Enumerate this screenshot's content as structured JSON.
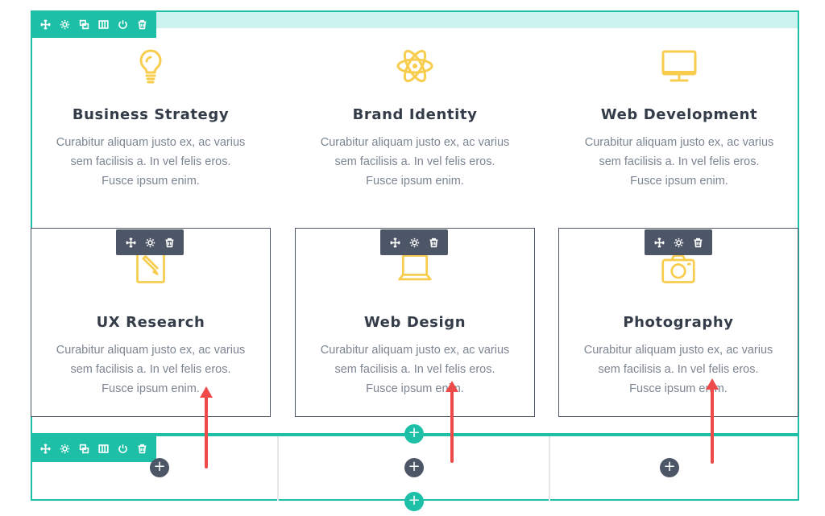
{
  "section": {
    "toolbar_icons": [
      "move-icon",
      "settings-icon",
      "duplicate-icon",
      "columns-icon",
      "disable-icon",
      "delete-icon"
    ]
  },
  "services_top": [
    {
      "icon": "lightbulb-icon",
      "title": "Business Strategy",
      "text": "Curabitur aliquam justo ex, ac varius sem facilisis a. In vel felis eros. Fusce ipsum enim."
    },
    {
      "icon": "atom-icon",
      "title": "Brand Identity",
      "text": "Curabitur aliquam justo ex, ac varius sem facilisis a. In vel felis eros. Fusce ipsum enim."
    },
    {
      "icon": "monitor-icon",
      "title": "Web Development",
      "text": "Curabitur aliquam justo ex, ac varius sem facilisis a. In vel felis eros. Fusce ipsum enim."
    }
  ],
  "services_bottom": [
    {
      "icon": "pencil-note-icon",
      "title": "UX Research",
      "text": "Curabitur aliquam justo ex, ac varius sem facilisis a. In vel felis eros. Fusce ipsum enim."
    },
    {
      "icon": "laptop-icon",
      "title": "Web Design",
      "text": "Curabitur aliquam justo ex, ac varius sem facilisis a. In vel felis eros. Fusce ipsum enim."
    },
    {
      "icon": "camera-icon",
      "title": "Photography",
      "text": "Curabitur aliquam justo ex, ac varius sem facilisis a. In vel felis eros. Fusce ipsum enim."
    }
  ],
  "module_toolbar_icons": [
    "move-icon",
    "settings-icon",
    "delete-icon"
  ],
  "add_symbol": "+",
  "colors": {
    "accent": "#1ebfa7",
    "dark": "#4d5666",
    "icon_yellow": "#f8cd4e",
    "annotation_arrow": "#ef4a4a"
  }
}
